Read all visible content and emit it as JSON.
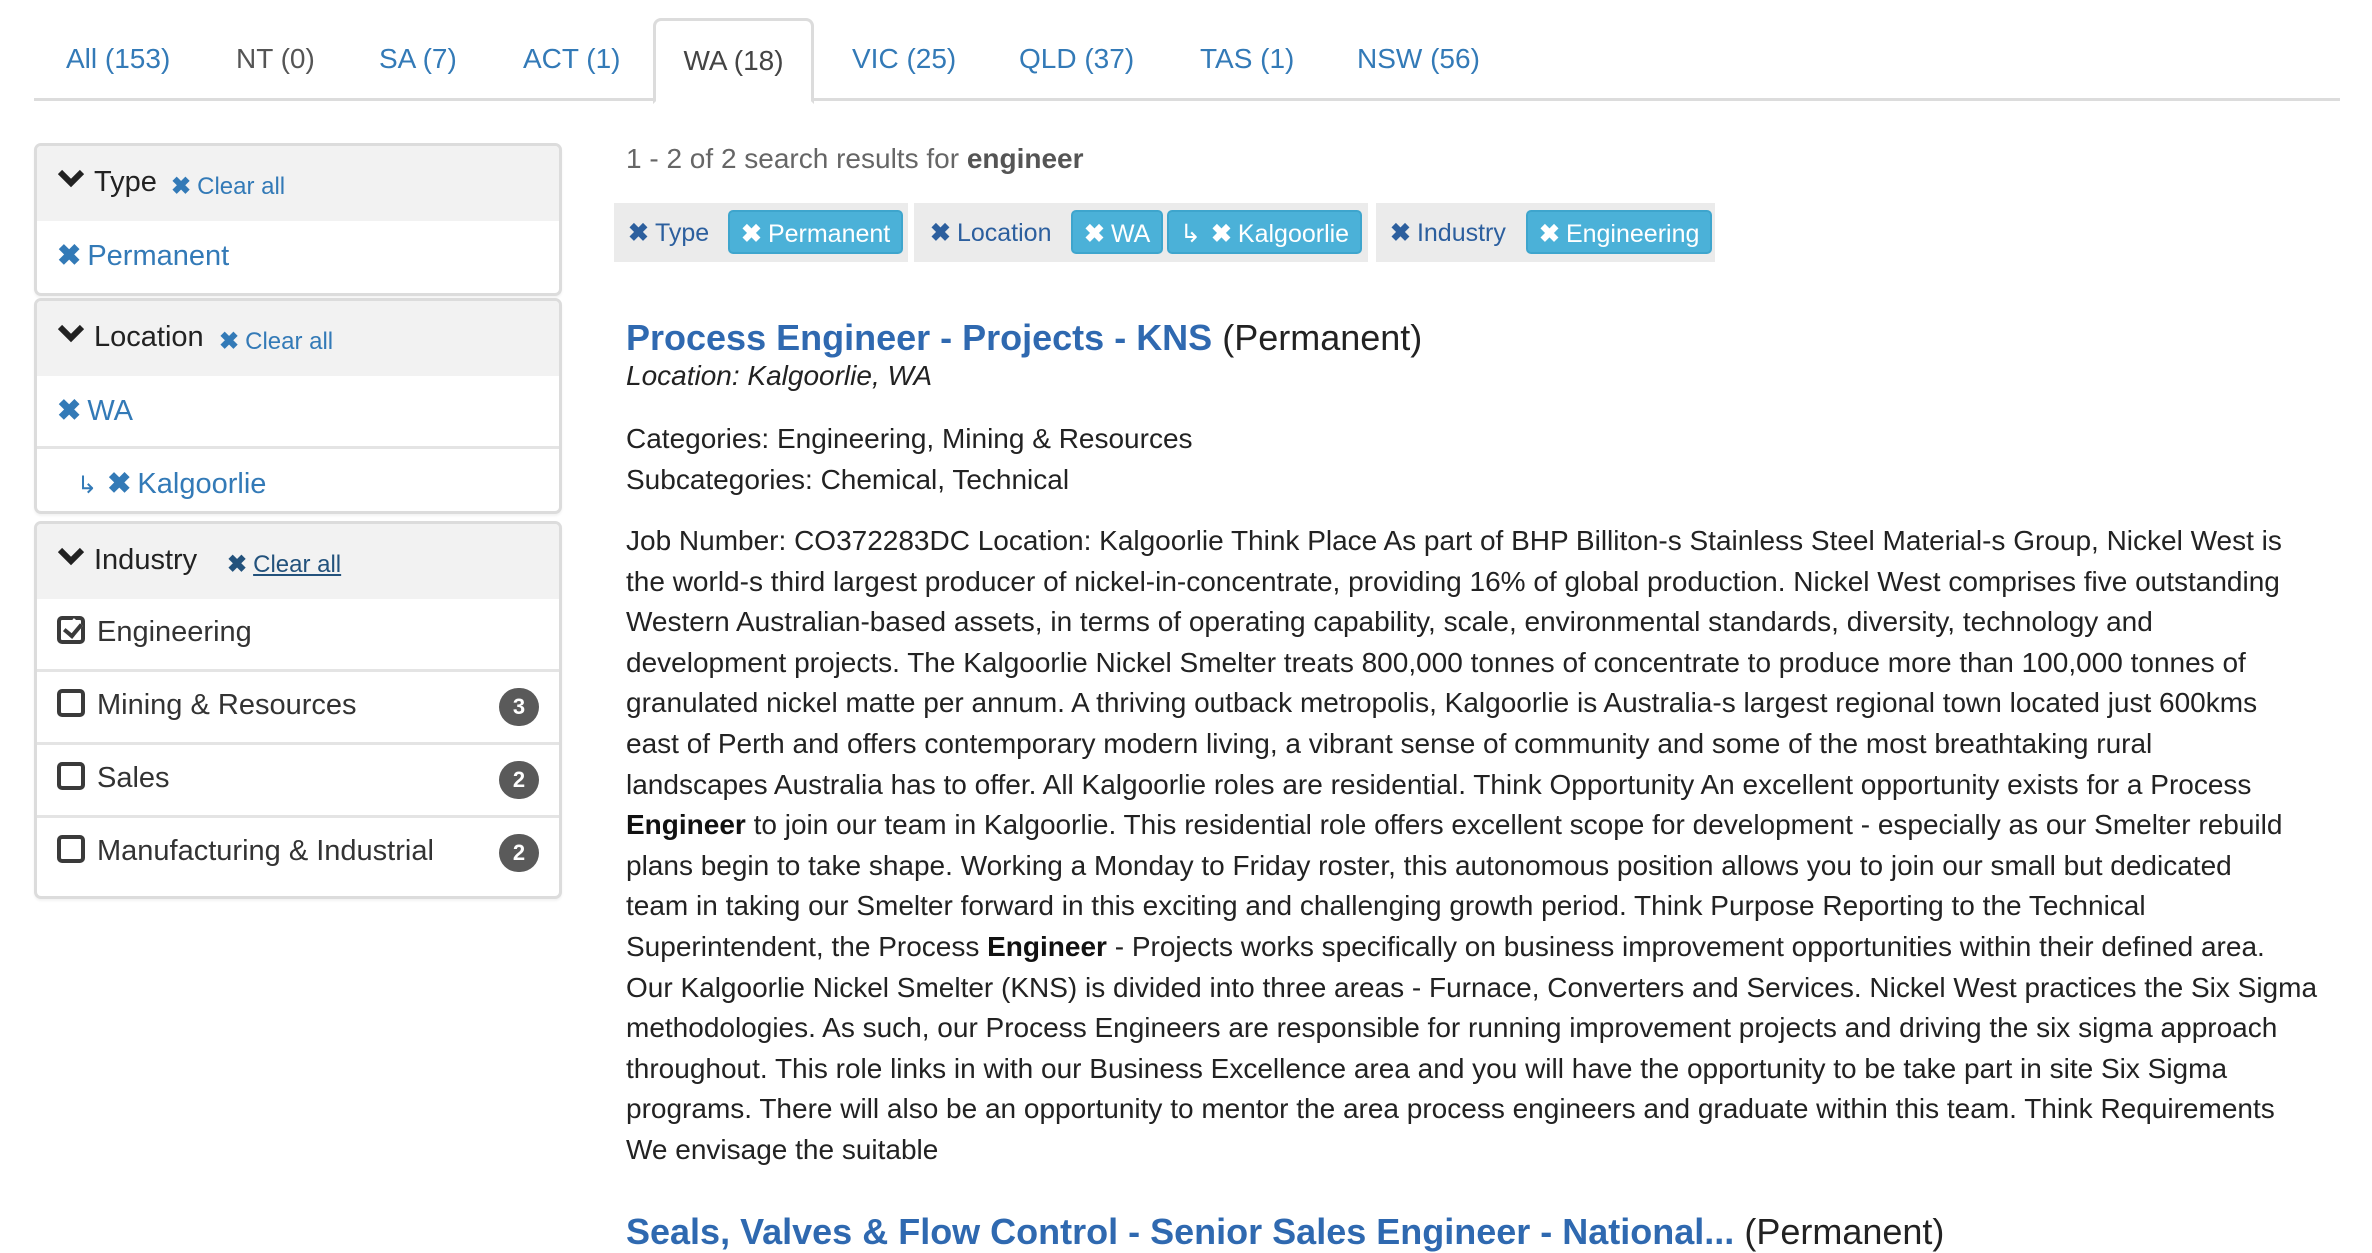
{
  "tabs": [
    {
      "label": "All (153)",
      "active": false
    },
    {
      "label": "NT (0)",
      "active": false
    },
    {
      "label": "SA (7)",
      "active": false
    },
    {
      "label": "ACT (1)",
      "active": false
    },
    {
      "label": "WA (18)",
      "active": true
    },
    {
      "label": "VIC (25)",
      "active": false
    },
    {
      "label": "QLD (37)",
      "active": false
    },
    {
      "label": "TAS (1)",
      "active": false
    },
    {
      "label": "NSW (56)",
      "active": false
    }
  ],
  "sidebar": {
    "clear_all_label": "Clear all",
    "type": {
      "title": "Type",
      "selected": [
        {
          "label": "Permanent"
        }
      ]
    },
    "location": {
      "title": "Location",
      "selected": [
        {
          "label": "WA"
        },
        {
          "label": "Kalgoorlie",
          "arrow": "↳"
        }
      ]
    },
    "industry": {
      "title": "Industry",
      "options": [
        {
          "label": "Engineering",
          "checked": true,
          "count": null
        },
        {
          "label": "Mining & Resources",
          "checked": false,
          "count": "3"
        },
        {
          "label": "Sales",
          "checked": false,
          "count": "2"
        },
        {
          "label": "Manufacturing & Industrial",
          "checked": false,
          "count": "2"
        }
      ]
    }
  },
  "search": {
    "summary_prefix": "1 - 2 of 2 search results for ",
    "query": "engineer"
  },
  "active_filters": [
    {
      "label": "Type",
      "chips": [
        "Permanent"
      ]
    },
    {
      "label": "Location",
      "chips": [
        "WA",
        "Kalgoorlie"
      ],
      "sub_arrow": "↳"
    },
    {
      "label": "Industry",
      "chips": [
        "Engineering"
      ]
    }
  ],
  "results": [
    {
      "title": "Process Engineer - Projects - KNS",
      "type": "(Permanent)",
      "location": "Location: Kalgoorlie, WA",
      "categories": "Categories: Engineering, Mining & Resources",
      "subcategories": "Subcategories: Chemical, Technical",
      "body_lines": [
        [
          "Job Number: CO372283DC Location: Kalgoorlie Think Place As part of BHP Billiton-s Stainless Steel Material-s Group, Nickel West is"
        ],
        [
          "the world-s third largest producer of nickel-in-concentrate, providing 16% of global production. Nickel West comprises five outstanding"
        ],
        [
          "Western Australian-based assets, in terms of operating capability, scale, environmental standards, diversity, technology and"
        ],
        [
          "development projects. The Kalgoorlie Nickel Smelter treats 800,000 tonnes of concentrate to produce more than 100,000 tonnes of"
        ],
        [
          "granulated nickel matte per annum. A thriving outback metropolis, Kalgoorlie is Australia-s largest regional town located just 600kms"
        ],
        [
          "east of Perth and offers contemporary modern living, a vibrant sense of community and some of the most breathtaking rural"
        ],
        [
          "landscapes Australia has to offer. All Kalgoorlie roles are residential. Think Opportunity An excellent opportunity exists for a Process"
        ],
        [
          "",
          "Engineer",
          " to join our team in Kalgoorlie. This residential role offers excellent scope for development - especially as our Smelter rebuild"
        ],
        [
          "plans begin to take shape. Working a Monday to Friday roster, this autonomous position allows you to join our small but dedicated"
        ],
        [
          "team in taking our Smelter forward in this exciting and challenging growth period. Think Purpose Reporting to the Technical"
        ],
        [
          "Superintendent, the Process ",
          "Engineer",
          " - Projects works specifically on business improvement opportunities within their defined area."
        ],
        [
          "Our Kalgoorlie Nickel Smelter (KNS) is divided into three areas - Furnace, Converters and Services. Nickel West practices the Six Sigma"
        ],
        [
          "methodologies. As such, our Process Engineers are responsible for running improvement projects and driving the six sigma approach"
        ],
        [
          "throughout. This role links in with our Business Excellence area and you will have the opportunity to be take part in site Six Sigma"
        ],
        [
          "programs. There will also be an opportunity to mentor the area process engineers and graduate within this team. Think Requirements"
        ],
        [
          "We envisage the suitable"
        ]
      ]
    },
    {
      "title": "Seals, Valves & Flow Control - Senior Sales Engineer - National...",
      "type": "(Permanent)"
    }
  ],
  "colors": {
    "link": "#337ab7",
    "link_hover": "#23527c",
    "chip_bg": "#4bb1d8",
    "badge_bg": "#5a5a5a",
    "panel_head_bg": "#f2f2f2"
  }
}
